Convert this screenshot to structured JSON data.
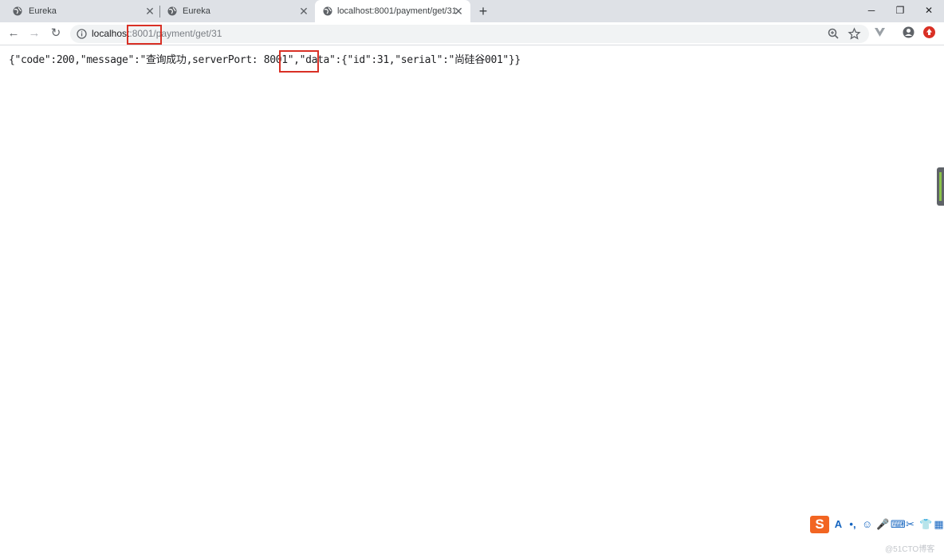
{
  "tabs": [
    {
      "title": "Eureka"
    },
    {
      "title": "Eureka"
    },
    {
      "title": "localhost:8001/payment/get/31"
    }
  ],
  "window": {
    "minimize": "─",
    "maximize": "❐",
    "close": "✕"
  },
  "address_bar": {
    "url_host": "localhost",
    "url_rest": ":8001/payment/get/31"
  },
  "response": {
    "segments": [
      "{\"code\":200,\"message\":\"查询成功,serverPort: ",
      "8001",
      "\",\"data\":{\"id\":31,\"serial\":\"尚硅谷001\"}}"
    ]
  },
  "ime_bar": {
    "logo": "S",
    "items": [
      "A",
      "•,",
      "☺",
      "🎤",
      "⌨",
      "✂",
      "👕",
      "▦"
    ]
  },
  "watermark": "@51CTO博客"
}
